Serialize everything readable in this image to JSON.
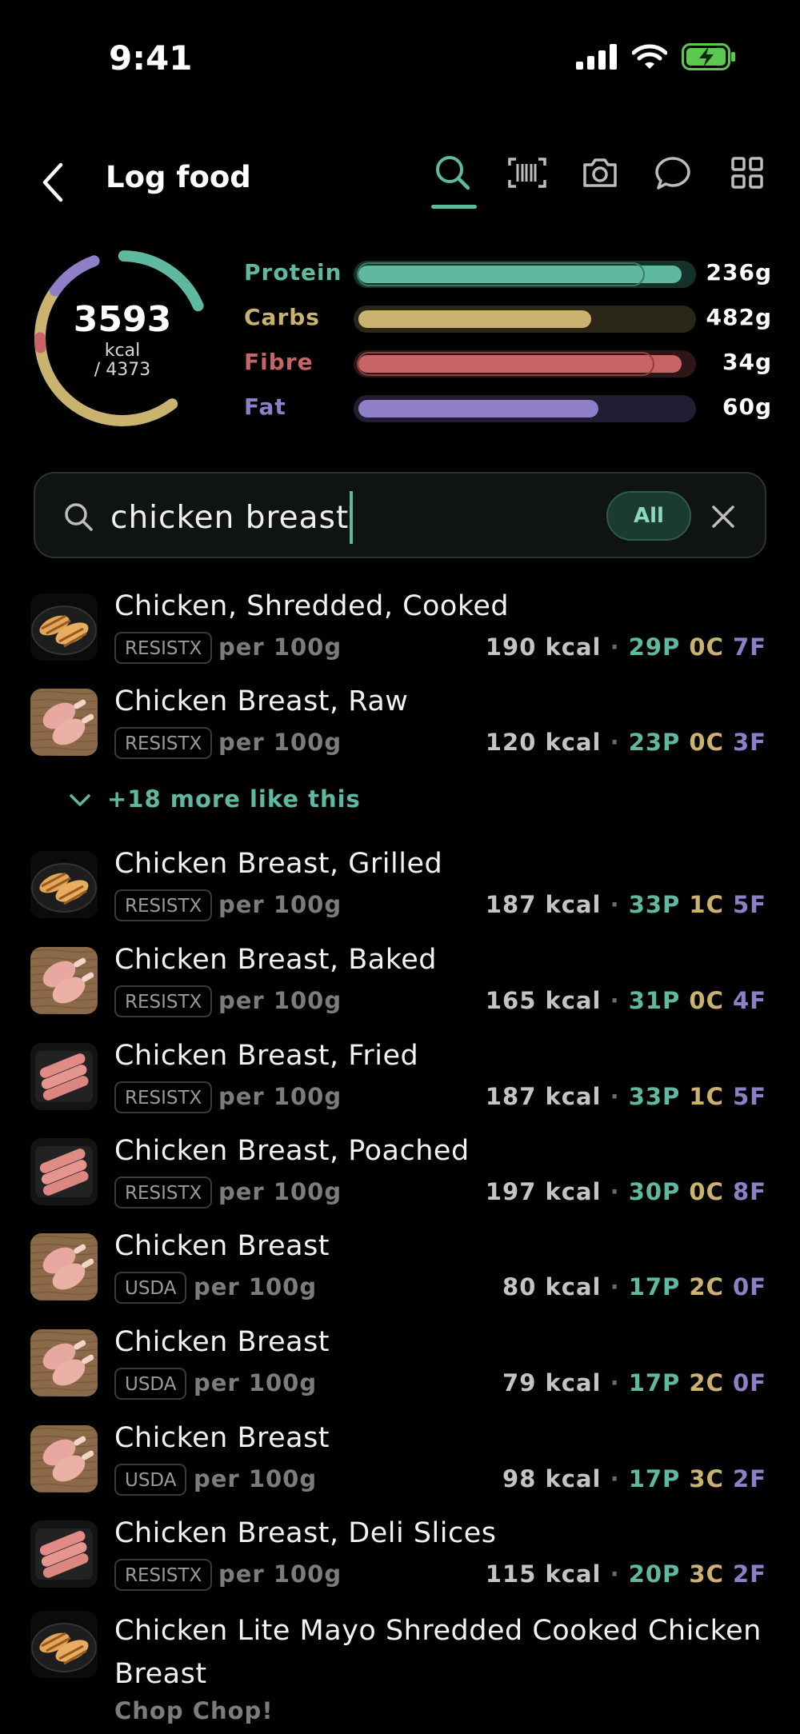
{
  "status": {
    "time": "9:41"
  },
  "header": {
    "title": "Log food",
    "tools": [
      "search-icon",
      "barcode-icon",
      "camera-icon",
      "chat-icon",
      "grid-icon"
    ]
  },
  "summary": {
    "kcal": "3593",
    "kcal_unit": "kcal",
    "kcal_goal": "/ 4373",
    "macros": [
      {
        "label": "Protein",
        "value": "236g",
        "fill": 0.97,
        "color": "#5fb8a0",
        "track": "#16312a"
      },
      {
        "label": "Carbs",
        "value": "482g",
        "fill": 0.7,
        "color": "#c9b36e",
        "track": "#2a2718"
      },
      {
        "label": "Fibre",
        "value": "34g",
        "fill": 0.97,
        "color": "#c86466",
        "track": "#2c1617"
      },
      {
        "label": "Fat",
        "value": "60g",
        "fill": 0.72,
        "color": "#8f7fc6",
        "track": "#211d33"
      }
    ]
  },
  "search": {
    "value": "chicken breast",
    "filter": "All"
  },
  "results": [
    {
      "name": "Chicken, Shredded, Cooked",
      "source": "RESISTX",
      "per": "per 100g",
      "kcal": "190 kcal",
      "p": "29P",
      "c": "0C",
      "f": "7F",
      "img": "grilled"
    },
    {
      "name": "Chicken Breast, Raw",
      "source": "RESISTX",
      "per": "per 100g",
      "kcal": "120 kcal",
      "p": "23P",
      "c": "0C",
      "f": "3F",
      "img": "drumsticks"
    },
    {
      "name": "Chicken Breast, Grilled",
      "source": "RESISTX",
      "per": "per 100g",
      "kcal": "187 kcal",
      "p": "33P",
      "c": "1C",
      "f": "5F",
      "img": "grilled"
    },
    {
      "name": "Chicken Breast, Baked",
      "source": "RESISTX",
      "per": "per 100g",
      "kcal": "165 kcal",
      "p": "31P",
      "c": "0C",
      "f": "4F",
      "img": "drumsticks"
    },
    {
      "name": "Chicken Breast, Fried",
      "source": "RESISTX",
      "per": "per 100g",
      "kcal": "187 kcal",
      "p": "33P",
      "c": "1C",
      "f": "5F",
      "img": "sausages"
    },
    {
      "name": "Chicken Breast, Poached",
      "source": "RESISTX",
      "per": "per 100g",
      "kcal": "197 kcal",
      "p": "30P",
      "c": "0C",
      "f": "8F",
      "img": "sausages"
    },
    {
      "name": "Chicken Breast",
      "source": "USDA",
      "per": "per 100g",
      "kcal": "80 kcal",
      "p": "17P",
      "c": "2C",
      "f": "0F",
      "img": "drumsticks"
    },
    {
      "name": "Chicken Breast",
      "source": "USDA",
      "per": "per 100g",
      "kcal": "79 kcal",
      "p": "17P",
      "c": "2C",
      "f": "0F",
      "img": "drumsticks"
    },
    {
      "name": "Chicken Breast",
      "source": "USDA",
      "per": "per 100g",
      "kcal": "98 kcal",
      "p": "17P",
      "c": "3C",
      "f": "2F",
      "img": "drumsticks"
    },
    {
      "name": "Chicken Breast, Deli Slices",
      "source": "RESISTX",
      "per": "per 100g",
      "kcal": "115 kcal",
      "p": "20P",
      "c": "3C",
      "f": "2F",
      "img": "sausages"
    }
  ],
  "more_like_this": "+18 more like this",
  "last_result": {
    "name": "Chicken Lite Mayo Shredded Cooked Chicken Breast",
    "brand": "Chop Chop!"
  },
  "dot": "·"
}
